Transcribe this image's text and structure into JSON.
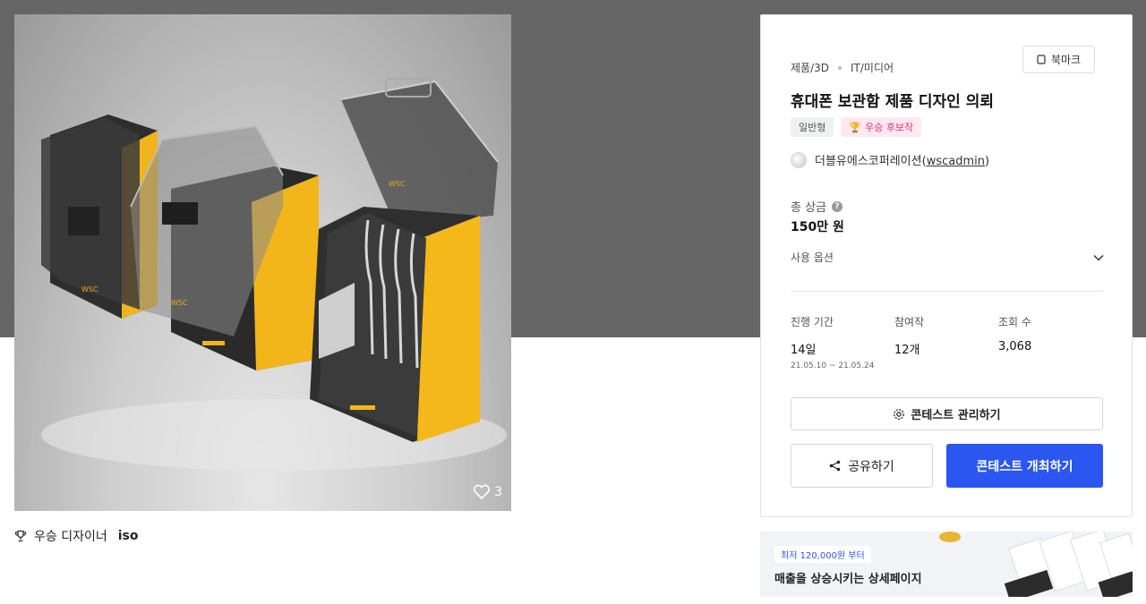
{
  "product": {
    "likes": "3",
    "award_label": "우승 디자이너",
    "award_name": "iso",
    "logo_text": "WSC"
  },
  "info": {
    "category_1": "제품/3D",
    "category_2": "IT/미디어",
    "bookmark_label": "북마크",
    "title": "휴대폰 보관함 제품 디자인 의뢰",
    "tag_type": "일반형",
    "tag_award": "우승 후보작",
    "host_name": "더블유에스코퍼레이션",
    "host_handle": "wscadmin",
    "prize_label": "총 상금",
    "prize_value": "150만 원",
    "usage_label": "사용 옵션",
    "stats": [
      {
        "label": "진행 기간",
        "value": "14일",
        "sub": "21.05.10 ~ 21.05.24"
      },
      {
        "label": "참여작",
        "value": "12개"
      },
      {
        "label": "조회 수",
        "value": "3,068"
      }
    ],
    "manage_label": "콘테스트 관리하기",
    "share_label": "공유하기",
    "host_contest_label": "콘테스트 개최하기",
    "accent_color": "#2b56f0"
  },
  "ad": {
    "pill": "최저 120,000원 부터",
    "headline": "매출을 상승시키는 상세페이지"
  }
}
